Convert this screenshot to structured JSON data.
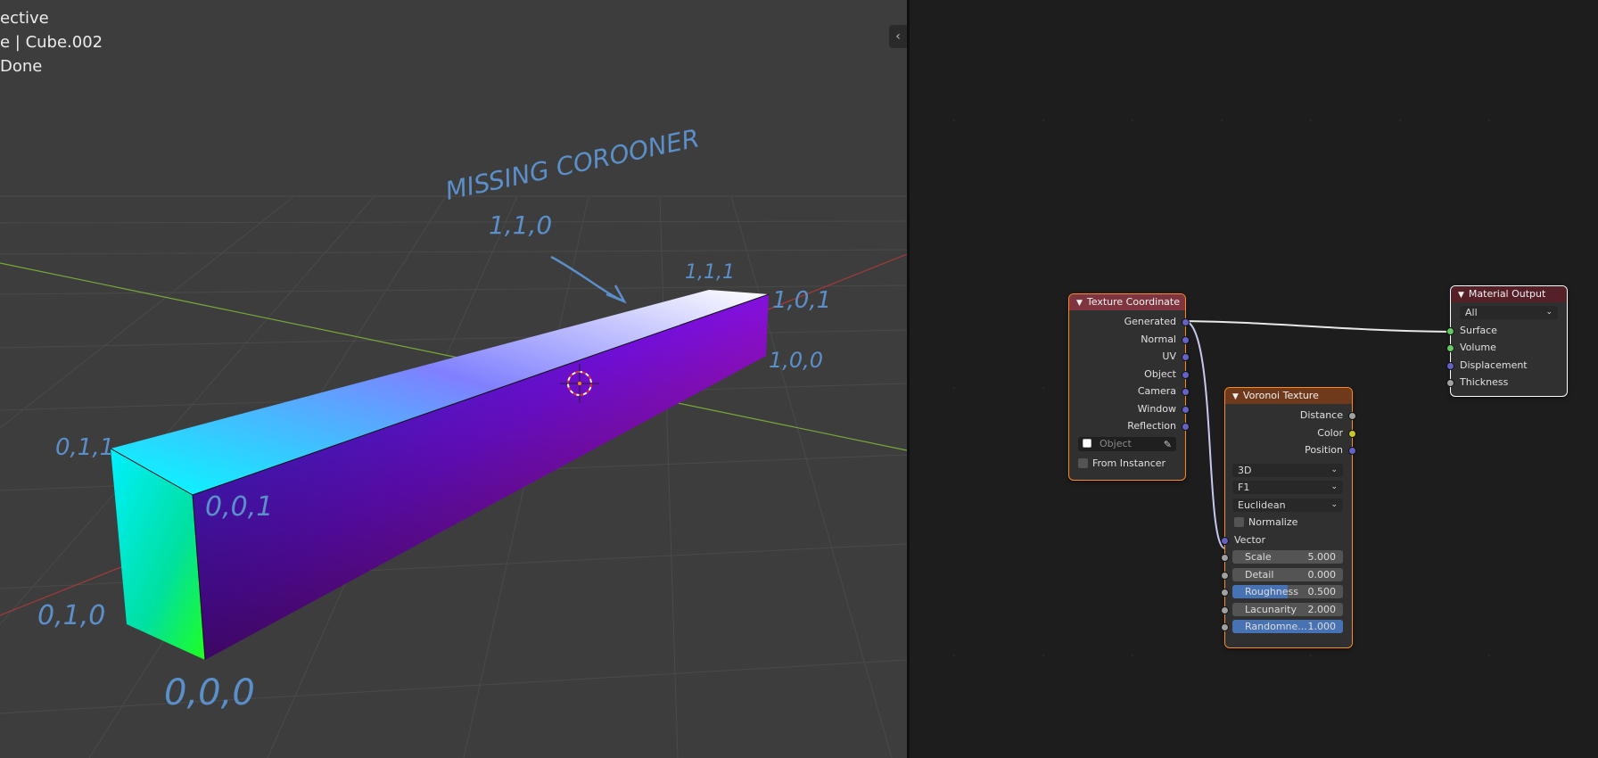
{
  "viewport": {
    "overlay": {
      "line1": "ective",
      "line2": "e | Cube.002",
      "line3": "Done"
    },
    "annotations": {
      "missing_label": "MISSING COROONER",
      "corner_110": "1,1,0",
      "corner_111": "1,1,1",
      "corner_101": "1,0,1",
      "corner_100": "1,0,0",
      "corner_011": "0,1,1",
      "corner_001": "0,0,1",
      "corner_010": "0,1,0",
      "corner_000": "0,0,0"
    },
    "colors": {
      "annotation": "#5b8fc9"
    }
  },
  "node_editor": {
    "texture_coordinate": {
      "title": "Texture Coordinate",
      "outputs": [
        "Generated",
        "Normal",
        "UV",
        "Object",
        "Camera",
        "Window",
        "Reflection"
      ],
      "object_placeholder": "Object",
      "from_instancer": "From Instancer"
    },
    "voronoi": {
      "title": "Voronoi Texture",
      "outputs": [
        "Distance",
        "Color",
        "Position"
      ],
      "dimensions": "3D",
      "feature": "F1",
      "metric": "Euclidean",
      "normalize": "Normalize",
      "vector": "Vector",
      "fields": [
        {
          "label": "Scale",
          "value": "5.000",
          "fill": 0
        },
        {
          "label": "Detail",
          "value": "0.000",
          "fill": 0
        },
        {
          "label": "Roughness",
          "value": "0.500",
          "fill": 0.5
        },
        {
          "label": "Lacunarity",
          "value": "2.000",
          "fill": 0
        },
        {
          "label": "Randomne...",
          "value": "1.000",
          "fill": 1
        }
      ]
    },
    "material_output": {
      "title": "Material Output",
      "target": "All",
      "inputs": [
        "Surface",
        "Volume",
        "Displacement",
        "Thickness"
      ]
    },
    "colors": {
      "tex_coord_header": "#7e3540",
      "voronoi_header": "#6f3a1c",
      "output_header": "#562029",
      "vector_socket": "#6363c7",
      "color_socket": "#c7c729",
      "float_socket": "#a1a1a1",
      "shader_socket": "#63c763"
    }
  }
}
